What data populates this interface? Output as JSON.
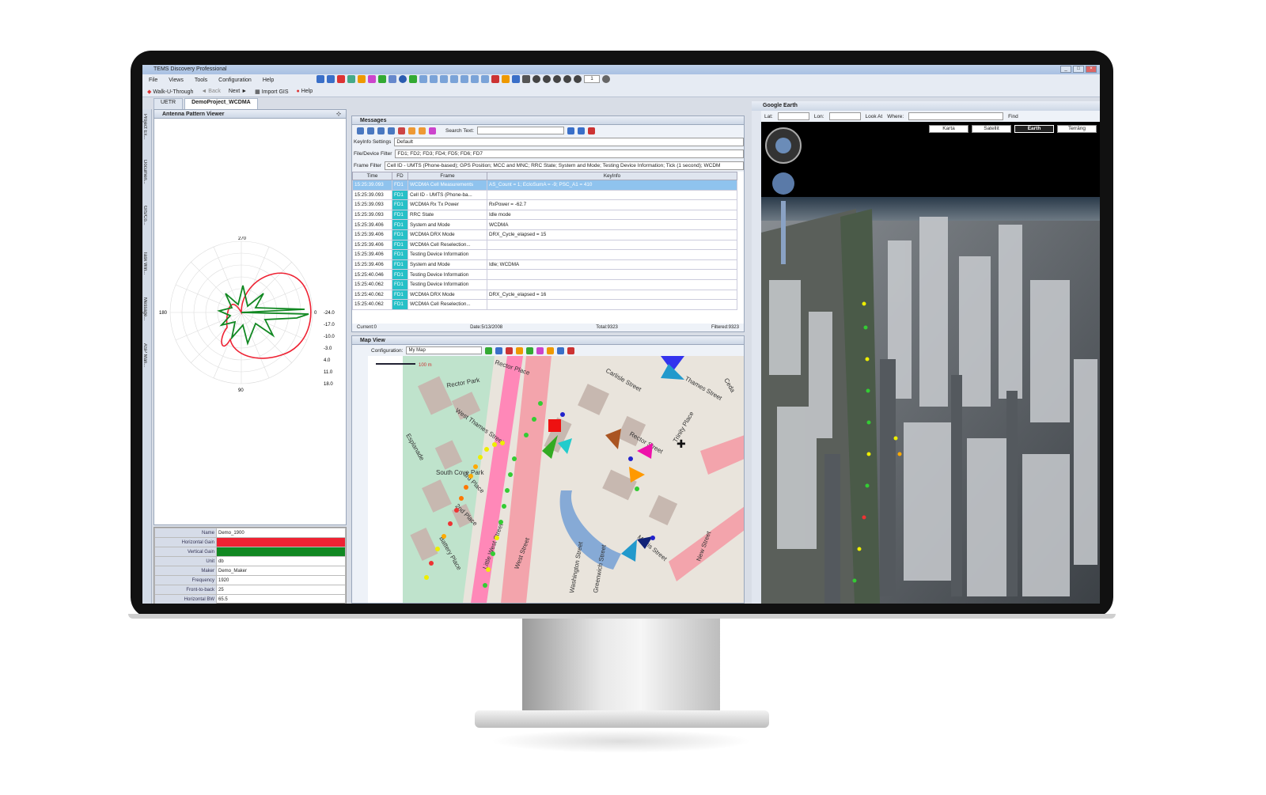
{
  "window": {
    "title": "TEMS Discovery Professional"
  },
  "menu": [
    "File",
    "Views",
    "Tools",
    "Configuration",
    "Help"
  ],
  "toolbar": {
    "walk": "Walk-U-Through",
    "back": "Back",
    "next": "Next",
    "import": "Import GIS",
    "help": "Help",
    "page": "1"
  },
  "tabs": [
    "UETR",
    "DemoProject_WCDMA"
  ],
  "left_strip": [
    "Project Ex...",
    "Documen...",
    "GIS/Co...",
    "Task Win...",
    "Message...",
    "ASP Man..."
  ],
  "antenna": {
    "title": "Antenna Pattern Viewer",
    "angles": [
      "270",
      "180",
      "0",
      "90"
    ],
    "rings": [
      "-24.0",
      "-17.0",
      "-10.0",
      "-3.0",
      "4.0",
      "11.0",
      "18.0"
    ],
    "props": [
      {
        "k": "Name",
        "v": "Demo_1900"
      },
      {
        "k": "Horizontal Gain",
        "v": ""
      },
      {
        "k": "Vertical Gain",
        "v": ""
      },
      {
        "k": "Unit",
        "v": "db"
      },
      {
        "k": "Maker",
        "v": "Demo_Maker"
      },
      {
        "k": "Frequency",
        "v": "1920"
      },
      {
        "k": "Front-to-back",
        "v": "25"
      },
      {
        "k": "Horizontal BW",
        "v": "65.5"
      }
    ],
    "colors": {
      "horizontal": "#ee2233",
      "vertical": "#118822"
    }
  },
  "messages": {
    "title": "Messages",
    "search_label": "Search Text:",
    "keyinfo_label": "KeyInfo Settings",
    "keyinfo_value": "Default",
    "device_label": "File/Device Filter",
    "device_value": "FD1; FD2; FD3; FD4; FD5; FD6; FD7",
    "frame_label": "Frame Filter",
    "frame_value": "Cell ID - UMTS (Phone-based); GPS Position; MCC and MNC; RRC State; System and Mode; Testing Device Information; Tick (1 second); WCDM",
    "columns": [
      "Time",
      "FD",
      "Frame",
      "KeyInfo"
    ],
    "rows": [
      [
        "15:25:39.093",
        "FD1",
        "WCDMA Cell Measurements",
        "AS_Count = 1; EcIoSumA = -9; PSC_A1 = 410"
      ],
      [
        "15:25:39.093",
        "FD1",
        "Cell ID - UMTS (Phone-ba...",
        ""
      ],
      [
        "15:25:39.093",
        "FD1",
        "WCDMA Rx Tx Power",
        "RxPower = -62.7"
      ],
      [
        "15:25:39.093",
        "FD1",
        "RRC State",
        "Idle mode"
      ],
      [
        "15:25:39.406",
        "FD1",
        "System and Mode",
        "WCDMA"
      ],
      [
        "15:25:39.406",
        "FD1",
        "WCDMA DRX Mode",
        "DRX_Cycle_elapsed = 15"
      ],
      [
        "15:25:39.406",
        "FD1",
        "WCDMA Cell Reselection...",
        ""
      ],
      [
        "15:25:39.406",
        "FD1",
        "Testing Device Information",
        ""
      ],
      [
        "15:25:39.406",
        "FD1",
        "System and Mode",
        "Idle; WCDMA"
      ],
      [
        "15:25:40.046",
        "FD1",
        "Testing Device Information",
        ""
      ],
      [
        "15:25:40.062",
        "FD1",
        "Testing Device Information",
        ""
      ],
      [
        "15:25:40.062",
        "FD1",
        "WCDMA DRX Mode",
        "DRX_Cycle_elapsed = 16"
      ],
      [
        "15:25:40.062",
        "FD1",
        "WCDMA Cell Reselection...",
        ""
      ]
    ],
    "status": {
      "current": "Current:0",
      "date": "Date:5/13/2008",
      "total": "Total:9323",
      "filtered": "Filtered:9323"
    }
  },
  "map": {
    "title": "Map View",
    "config_label": "Configuration:",
    "config_value": "My Map",
    "scale": "100 m",
    "streets": [
      "Rector Place",
      "Carlisle Street",
      "Thames Street",
      "Rector Park",
      "West Thames Street",
      "Esplanade",
      "South Cove Park",
      "3rd Place",
      "2nd Place",
      "Battery Place",
      "Little West Street",
      "West Street",
      "Washington Street",
      "Greenwich Street",
      "Morris Street",
      "New Street",
      "Trinity Place",
      "Rector Street",
      "Ceda"
    ]
  },
  "earth": {
    "title": "Google Earth",
    "lat_label": "Lat:",
    "lon_label": "Lon:",
    "lookat": "Look At",
    "where_label": "Where:",
    "find": "Find",
    "views": [
      "Karta",
      "Satellit",
      "Earth",
      "Terräng"
    ]
  }
}
